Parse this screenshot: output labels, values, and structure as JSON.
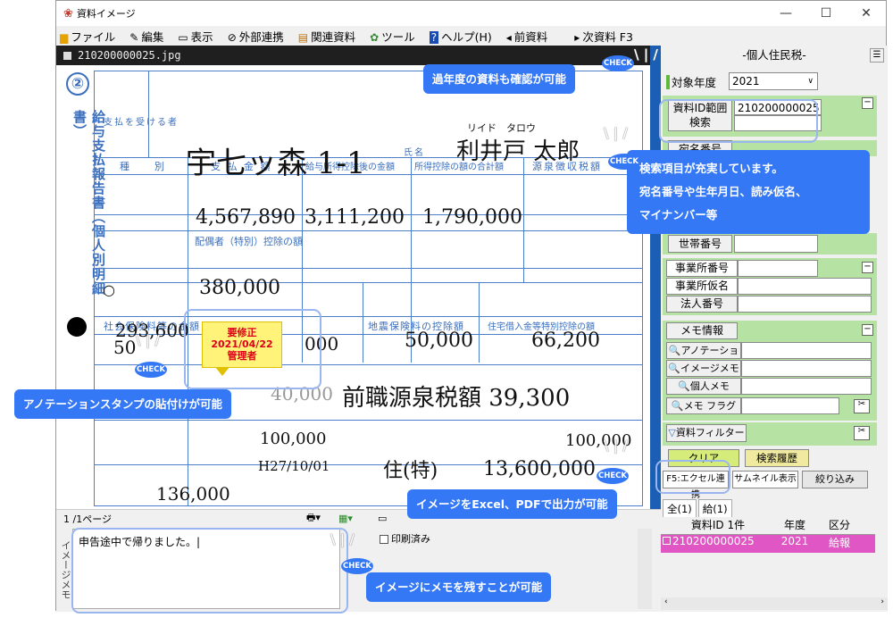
{
  "window": {
    "title": "資料イメージ"
  },
  "menu": [
    {
      "icon": "folder-icon",
      "label": "ファイル"
    },
    {
      "icon": "edit-icon",
      "label": "編集"
    },
    {
      "icon": "monitor-icon",
      "label": "表示"
    },
    {
      "icon": "link-icon",
      "label": "外部連携"
    },
    {
      "icon": "docs-icon",
      "label": "関連資料"
    },
    {
      "icon": "tools-icon",
      "label": "ツール"
    },
    {
      "icon": "help-icon",
      "label": "ヘルプ(H)"
    },
    {
      "icon": "prev-icon",
      "label": "前資料"
    },
    {
      "icon": "next-icon",
      "label": "次資料 F3"
    }
  ],
  "image": {
    "filename": "210200000025.jpg",
    "page_indicator": "1 /1ページ"
  },
  "form": {
    "title": "給与支払報告書（個人別明細書）",
    "number": "②",
    "address": "宇七ッ森 1-1",
    "furigana": "リイド　タロウ",
    "name": "利井戸 太郎",
    "payment": "4,567,890",
    "after_deduction": "3,111,200",
    "deduction_total": "1,790,000",
    "spouse_deduction": "380,000",
    "spouse_flag": "○",
    "ins1": "293,600",
    "ins2": "50",
    "ins3": "000",
    "earthquake": "50,000",
    "housing": "66,200",
    "prev_note": "前職源泉税額 39,300",
    "prev_amount": "40,000",
    "life1": "100,000",
    "date": "H27/10/01",
    "tax_tag": "住(特)",
    "amount2": "13,600,000",
    "amount3": "100,000",
    "amount4": "136,000"
  },
  "stamp": {
    "line1": "要修正",
    "line2": "2021/04/22",
    "line3": "管理者"
  },
  "memo": {
    "tab": "イメージメモ",
    "text": "申告途中で帰りました。|",
    "print_checkbox": "印刷済み"
  },
  "panel": {
    "title": "-個人住民税-",
    "year_label": "対象年度",
    "year_value": "2021",
    "id_label": "資料ID範囲検索",
    "id_value": "210200000025",
    "fields": [
      "宛名番号",
      "世帯番号",
      "事業所番号",
      "事業所仮名",
      "法人番号"
    ],
    "memo_label": "メモ情報",
    "memo_rows": [
      "アノテーション",
      "イメージメモ",
      "個人メモ",
      "メモ フラグ"
    ],
    "filter_label": "資料フィルター",
    "clear": "クリア",
    "history": "検索履歴",
    "excel": "F5:エクセル連携",
    "thumb": "サムネイル表示",
    "narrow": "絞り込み",
    "tabs": [
      "全(1)",
      "給(1)"
    ],
    "columns": [
      "資料ID 1件",
      "年度",
      "区分"
    ],
    "row": {
      "id": "210200000025",
      "year": "2021",
      "type": "給報"
    }
  },
  "callouts": {
    "c1": "過年度の資料も確認が可能",
    "c2_l1": "検索項目が充実しています。",
    "c2_l2": "宛名番号や生年月日、読み仮名、",
    "c2_l3": "マイナンバー等",
    "c3": "アノテーションスタンプの貼付けが可能",
    "c4": "イメージをExcel、PDFで出力が可能",
    "c5": "イメージにメモを残すことが可能",
    "badge": "CHECK"
  },
  "colors": {
    "accent": "#3478f6",
    "stamp": "#fff37a",
    "highlight": "#e056c4",
    "green": "#b6e3a3"
  }
}
